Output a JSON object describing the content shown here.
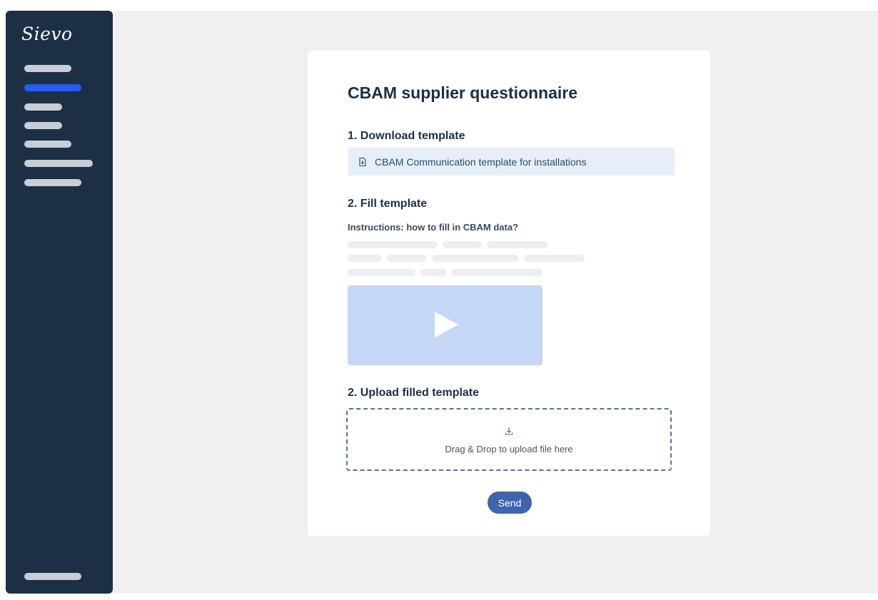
{
  "app": {
    "logo_text": "Sievo"
  },
  "sidebar": {
    "items": [
      "nav-item-1",
      "nav-item-2",
      "nav-item-3",
      "nav-item-4",
      "nav-item-5",
      "nav-item-6",
      "nav-item-7"
    ],
    "active_index": 1,
    "colors": {
      "background": "#1c2f45",
      "active": "#1f5ff0",
      "placeholder": "#c9ced6"
    }
  },
  "card": {
    "title": "CBAM supplier questionnaire",
    "step1": {
      "heading": "1. Download template",
      "link_label": "CBAM Communication template for installations",
      "icon": "file-download-icon"
    },
    "step2": {
      "heading": "2. Fill template",
      "instructions_label": "Instructions: how to fill in CBAM data?",
      "video_icon": "play-icon"
    },
    "step3": {
      "heading": "2. Upload filled template",
      "dropzone_text": "Drag & Drop to upload file here",
      "icon": "download-arrow-icon"
    },
    "send_label": "Send"
  },
  "colors": {
    "accent": "#3e64ac",
    "link_background": "#e6eef9",
    "video_placeholder": "#c5d7f6",
    "page_background": "#f0f0f0"
  }
}
